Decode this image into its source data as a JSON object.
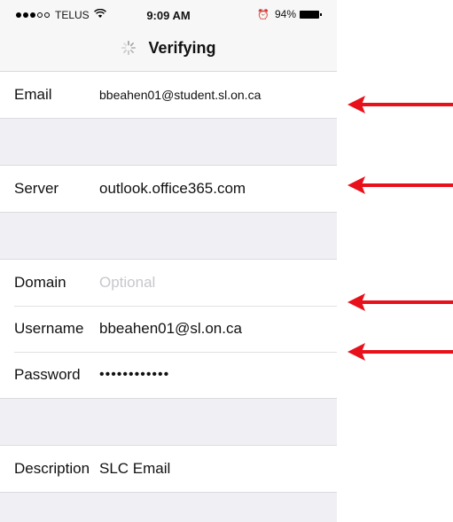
{
  "status_bar": {
    "carrier": "TELUS",
    "time": "9:09 AM",
    "battery": "94%",
    "icons": [
      "signal-dots",
      "wifi-icon",
      "alarm-icon",
      "battery-icon"
    ]
  },
  "nav": {
    "title": "Verifying",
    "icon": "spinner-icon"
  },
  "form": {
    "email": {
      "label": "Email",
      "value": "bbeahen01@student.sl.on.ca"
    },
    "server": {
      "label": "Server",
      "value": "outlook.office365.com"
    },
    "domain": {
      "label": "Domain",
      "placeholder": "Optional"
    },
    "username": {
      "label": "Username",
      "value": "bbeahen01@sl.on.ca"
    },
    "password": {
      "label": "Password",
      "value": "••••••••••••"
    },
    "description": {
      "label": "Description",
      "value": "SLC Email"
    }
  },
  "annotations": {
    "arrow_color": "#e8101a",
    "arrows": [
      "email-arrow",
      "server-arrow",
      "username-arrow",
      "password-arrow"
    ]
  }
}
